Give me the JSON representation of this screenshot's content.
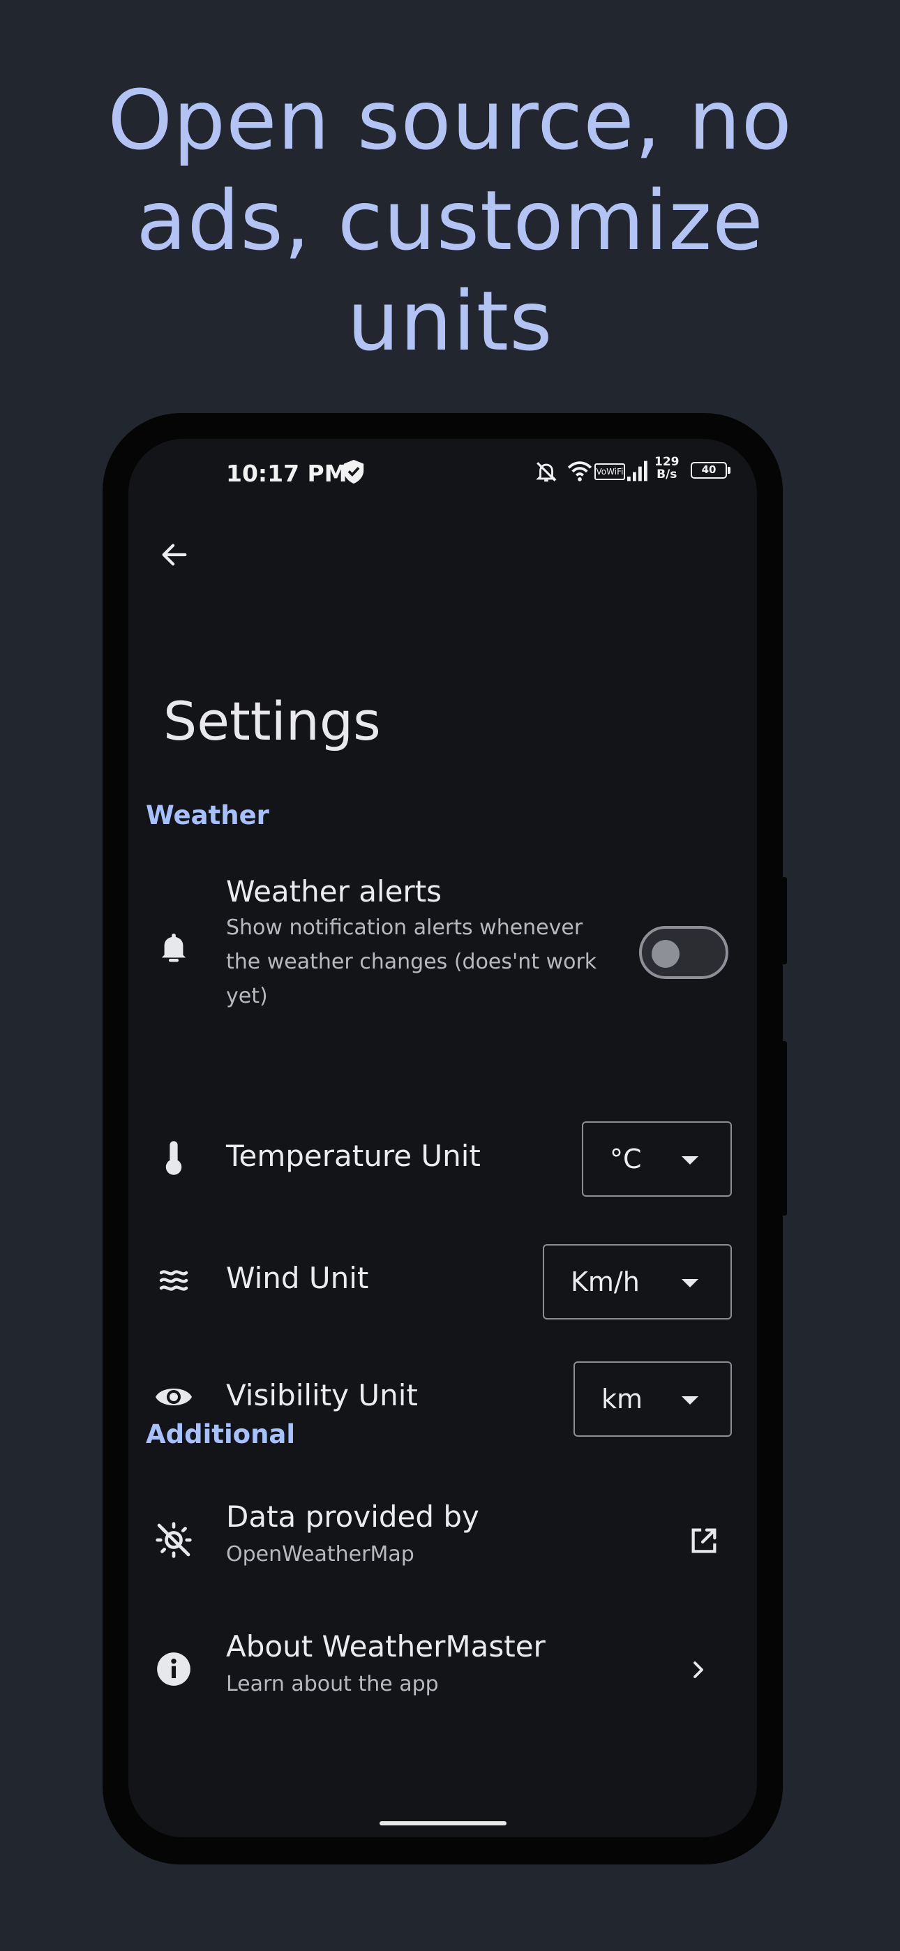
{
  "headline": {
    "line1": "Open source, no",
    "line2": "ads, customize",
    "line3": "units"
  },
  "status_bar": {
    "time": "10:17 PM",
    "net_speed_value": "129",
    "net_speed_unit": "B/s",
    "battery": "40",
    "volte_label": "VoWiFi",
    "icons": [
      "shield-icon",
      "bell-off-icon",
      "wifi-icon",
      "vowifi-icon",
      "signal-icon",
      "battery-icon"
    ]
  },
  "app_bar": {
    "back_icon": "arrow-back-icon"
  },
  "page_title": "Settings",
  "sections": {
    "weather": {
      "header": "Weather",
      "alerts": {
        "title": "Weather alerts",
        "subtitle_line1": "Show notification alerts whenever",
        "subtitle_line2": "the weather changes (does'nt work",
        "subtitle_line3": "yet)",
        "icon": "bell-icon",
        "toggle_on": false
      },
      "temperature": {
        "title": "Temperature Unit",
        "value": "°C",
        "icon": "thermometer-icon"
      },
      "wind": {
        "title": "Wind Unit",
        "value": "Km/h",
        "icon": "wind-icon"
      },
      "visibility": {
        "title": "Visibility Unit",
        "value": "km",
        "icon": "eye-icon"
      }
    },
    "additional": {
      "header": "Additional",
      "data_provider": {
        "title": "Data provided by",
        "subtitle": "OpenWeatherMap",
        "icon": "sun-icon",
        "trailing_icon": "open-external-icon"
      },
      "about": {
        "title": "About WeatherMaster",
        "subtitle": "Learn about the app",
        "icon": "info-icon",
        "trailing_icon": "chevron-right-icon"
      }
    }
  },
  "colors": {
    "background": "#22262e",
    "headline": "#b3c3f4",
    "screen": "#131418",
    "section_header": "#a7c0ff",
    "text_primary": "#ececf0",
    "text_secondary": "#b8b9be"
  }
}
